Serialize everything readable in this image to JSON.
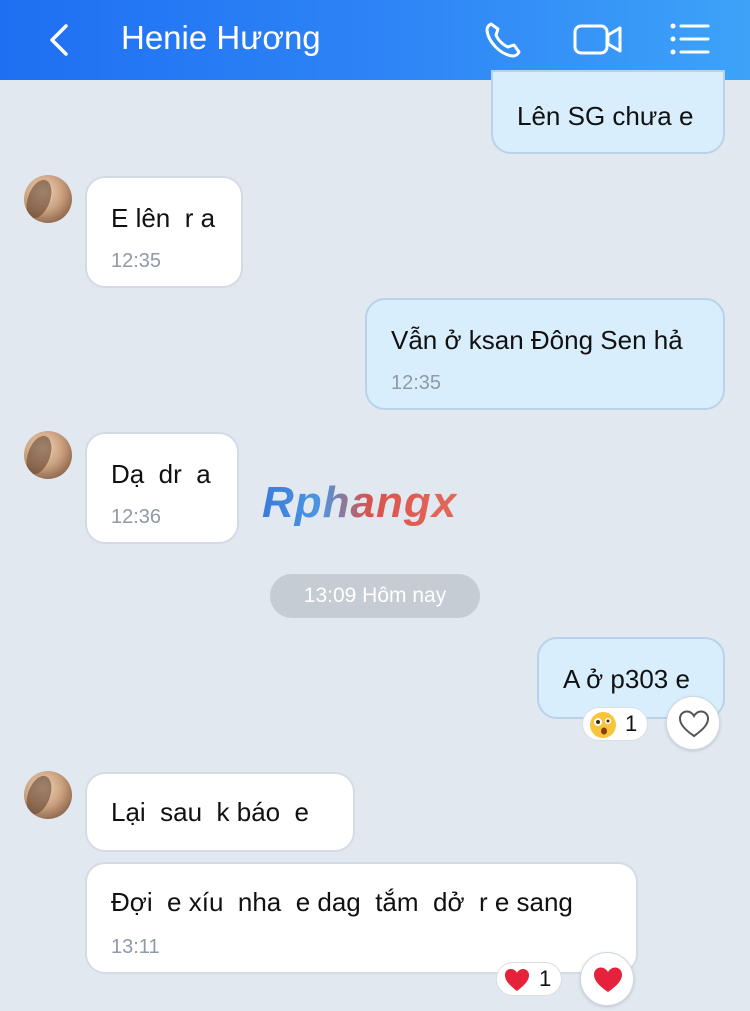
{
  "header": {
    "title": "Henie Hương",
    "back_icon": "chevron-left-icon",
    "call_icon": "phone-icon",
    "video_icon": "video-camera-icon",
    "menu_icon": "list-menu-icon",
    "color": "#2a7ff4"
  },
  "messages": [
    {
      "side": "out",
      "text": "Lên SG chưa e",
      "time": ""
    },
    {
      "side": "in",
      "text": "E lên  r a",
      "time": "12:35"
    },
    {
      "side": "out",
      "text": "Vẫn ở ksan Đông Sen hả",
      "time": "12:35"
    },
    {
      "side": "in",
      "text": "Dạ  dr  a",
      "time": "12:36"
    },
    {
      "side": "out",
      "text": "A ở p303 e",
      "time": ""
    },
    {
      "side": "in",
      "text": "Lại  sau  k báo  e",
      "time": ""
    },
    {
      "side": "in",
      "text": "Đợi  e xíu  nha  e dag  tắm  dở  r e sang",
      "time": "13:11"
    }
  ],
  "divider": {
    "text": "13:09 Hôm nay"
  },
  "reactions": [
    {
      "emoji": "surprised-face-icon",
      "count": "1"
    },
    {
      "emoji": "red-heart-icon",
      "count": "1"
    }
  ],
  "watermark": {
    "text": "Rphangx"
  }
}
